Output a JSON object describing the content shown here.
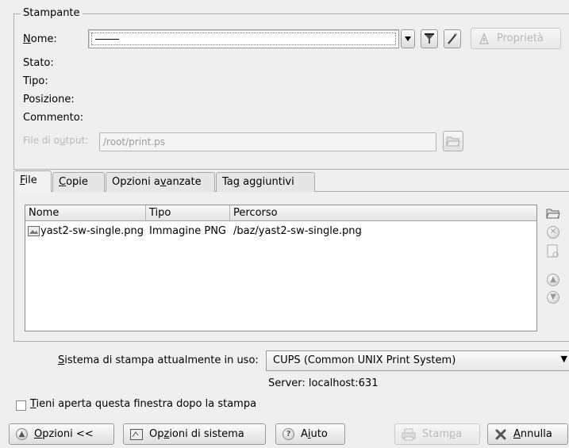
{
  "printer_group": {
    "title": "Stampante",
    "name_label": "Nome:",
    "name_mnemonic": "N",
    "name_rest": "ome:",
    "properties_button": "Proprietà",
    "status_label": "Stato:",
    "type_label": "Tipo:",
    "location_label": "Posizione:",
    "comment_label": "Commento:",
    "output_file_label_pre": "File di o",
    "output_file_label_mn": "u",
    "output_file_label_post": "tput:",
    "output_file_value": "/root/print.ps"
  },
  "tabs": [
    {
      "pre": "",
      "mn": "F",
      "post": "ile"
    },
    {
      "pre": "",
      "mn": "C",
      "post": "opie"
    },
    {
      "pre": "Opzioni a",
      "mn": "v",
      "post": "anzate"
    },
    {
      "pre": "Ta",
      "mn": "g",
      "post": " aggiuntivi"
    }
  ],
  "file_list": {
    "columns": [
      "Nome",
      "Tipo",
      "Percorso"
    ],
    "rows": [
      {
        "name": "yast2-sw-single.png",
        "type": "Immagine PNG",
        "path": "/baz/yast2-sw-single.png"
      }
    ]
  },
  "print_system": {
    "label_mn": "S",
    "label_rest": "istema di stampa attualmente in uso:",
    "value": "CUPS (Common UNIX Print System)",
    "server": "Server: localhost:631"
  },
  "keep_open": {
    "mn": "T",
    "rest": "ieni aperta questa finestra dopo la stampa"
  },
  "buttons": {
    "options": {
      "mn": "O",
      "rest": "pzioni <<"
    },
    "system_options": {
      "pre": "Op",
      "mn": "z",
      "post": "ioni di sistema"
    },
    "help": {
      "pre": "A",
      "mn": "i",
      "post": "uto"
    },
    "print": {
      "pre": "Stam",
      "mn": "p",
      "post": "a"
    },
    "cancel": {
      "mn": "A",
      "rest": "nnulla"
    }
  }
}
